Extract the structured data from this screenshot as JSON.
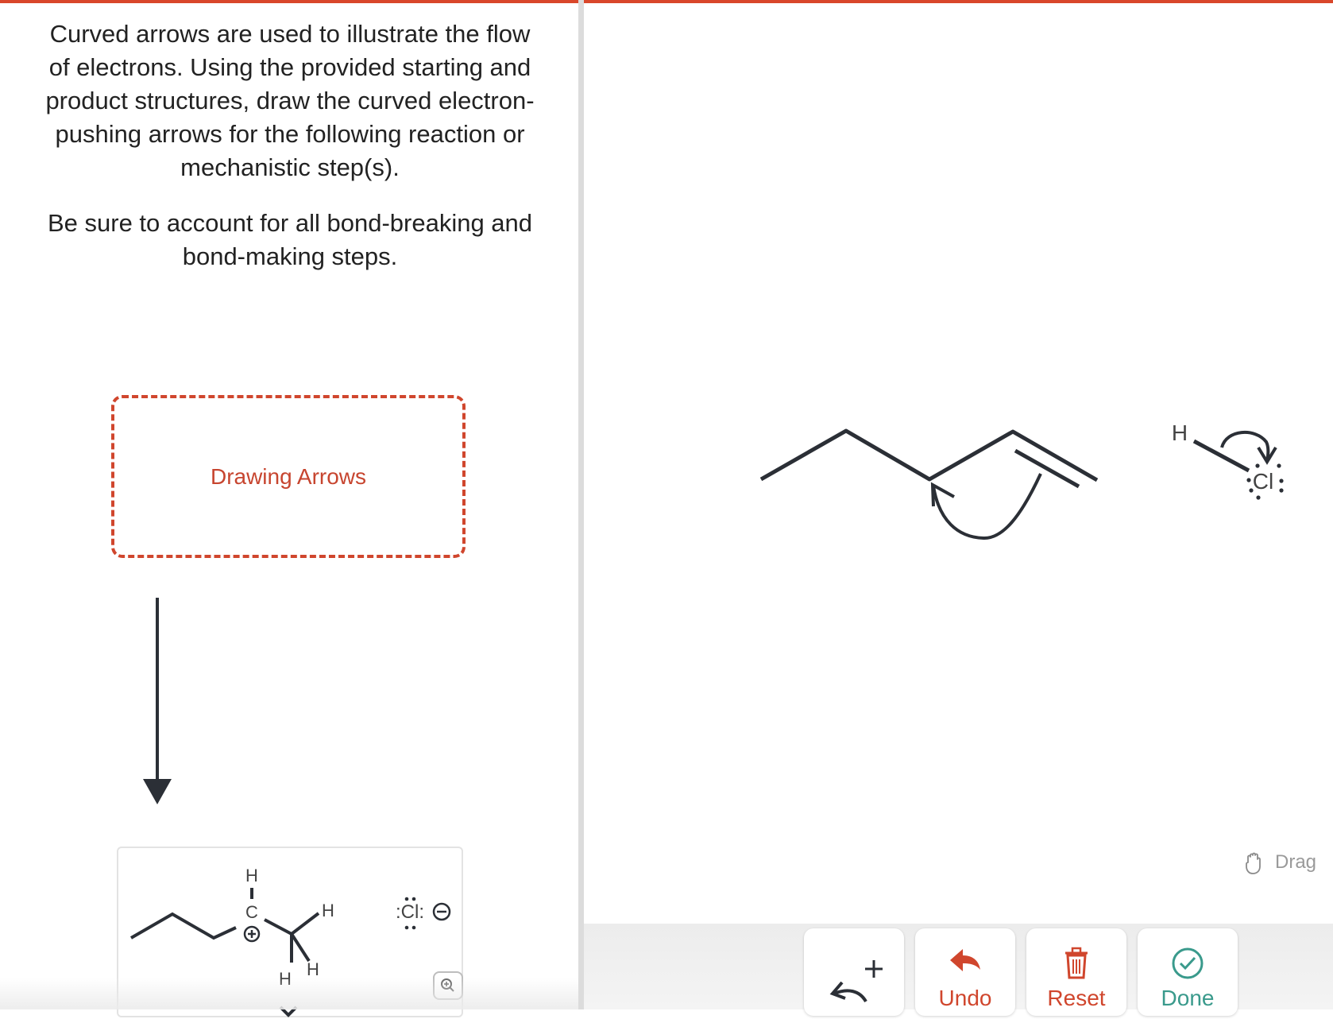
{
  "instructions": {
    "paragraph1": "Curved arrows are used to illustrate the flow of electrons. Using the provided starting and product structures, draw the curved electron-pushing arrows for the following reaction or mechanistic step(s).",
    "paragraph2": "Be sure to account for all bond-breaking and bond-making steps."
  },
  "drawing_box": {
    "label": "Drawing Arrows"
  },
  "product": {
    "h_top": "H",
    "c_label": "C",
    "h_right": "H",
    "h_bottom_left": "H",
    "h_bottom_right": "H",
    "cl_label": ":Cl:",
    "charge_plus": "+",
    "charge_minus": "−"
  },
  "canvas": {
    "h_label": "H",
    "cl_label": "Cl"
  },
  "drag_label": "Drag",
  "toolbar": {
    "arrow_tool_plus": "+",
    "undo_label": "Undo",
    "reset_label": "Reset",
    "done_label": "Done"
  },
  "colors": {
    "accent": "#d0462d",
    "done": "#3a9a8c",
    "ink": "#2b2f36"
  }
}
